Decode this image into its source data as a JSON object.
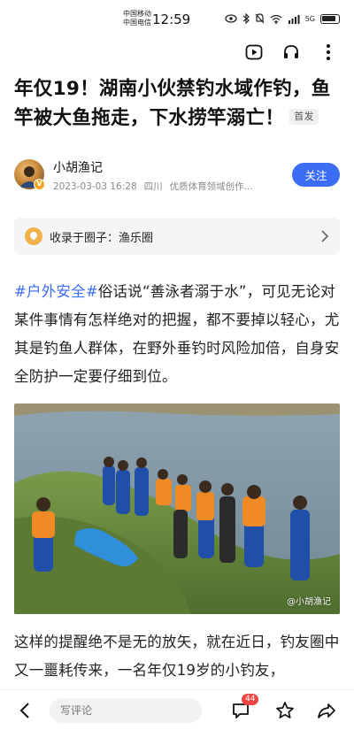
{
  "status_bar": {
    "carrier_1": "中国移动",
    "carrier_2": "中国电信",
    "time": "12:59",
    "net_label": "5G"
  },
  "toolbar": {
    "icons": [
      "video-play-icon",
      "headphones-icon",
      "more-vertical-icon"
    ]
  },
  "article": {
    "title": "年仅19！湖南小伙禁钓水域作钓，鱼竿被大鱼拖走，下水捞竿溺亡！",
    "first_badge": "首发",
    "author": {
      "name": "小胡渔记",
      "date": "2023-03-03 16:28",
      "location": "四川",
      "desc": "优质体育领域创作...",
      "follow_label": "关注"
    },
    "circle": {
      "text": "收录于圈子：渔乐圈"
    },
    "paragraph_1": {
      "hashtag": "#户外安全#",
      "body": "俗话说“善泳者溺于水”，可见无论对某件事情有怎样绝对的把握，都不要掉以轻心，尤其是钓鱼人群体，在野外垂钓时风险加倍，自身安全防护一定要仔细到位。"
    },
    "photo": {
      "watermark": "@小胡渔记"
    },
    "paragraph_2": "这样的提醒绝不是无的放矢，就在近日，钓友圈中又一噩耗传来，一名年仅19岁的小钓友，"
  },
  "bottom_bar": {
    "comment_placeholder": "写评论",
    "comment_count": "44",
    "icons": [
      "back-icon",
      "comment-icon",
      "star-icon",
      "share-icon"
    ]
  },
  "colors": {
    "accent": "#3b6ef5",
    "badge_red": "#f04444"
  }
}
